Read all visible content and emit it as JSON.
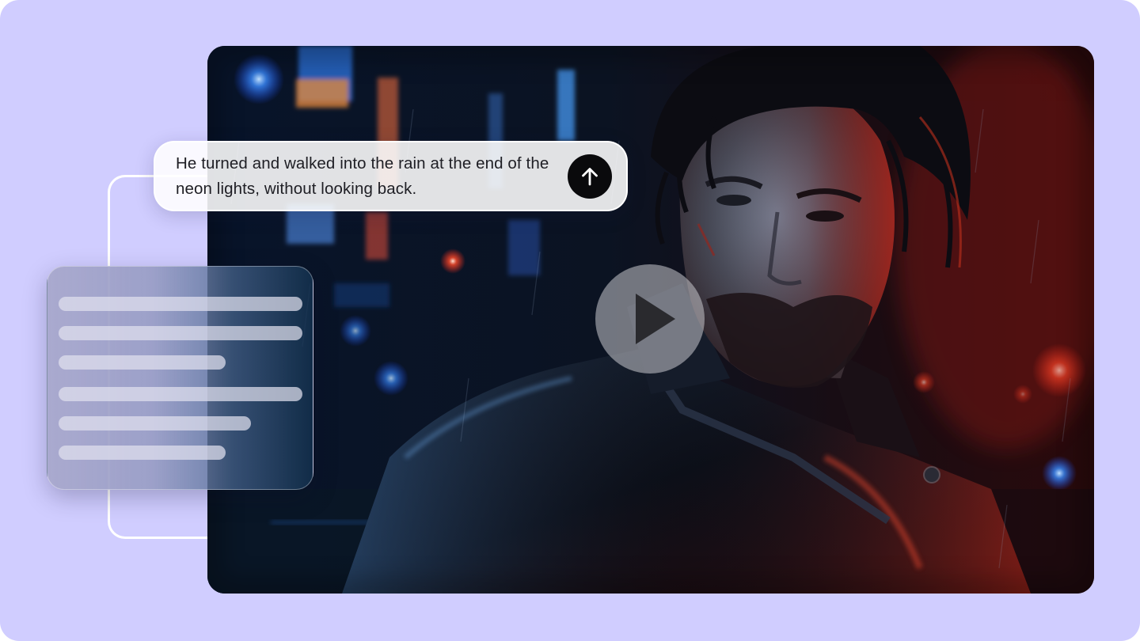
{
  "prompt": {
    "text": "He turned and walked into the rain at the end of the neon lights, without looking back.",
    "send_icon": "arrow-up-icon"
  },
  "video": {
    "play_icon": "play-icon",
    "description_icon": "rainy-neon-city-portrait"
  },
  "document_card": {
    "line_count": 6
  },
  "colors": {
    "background": "#d0cdff",
    "send_button": "#0a0a0c",
    "neon_blue": "#2a7bff",
    "neon_red": "#ff3a2a"
  }
}
